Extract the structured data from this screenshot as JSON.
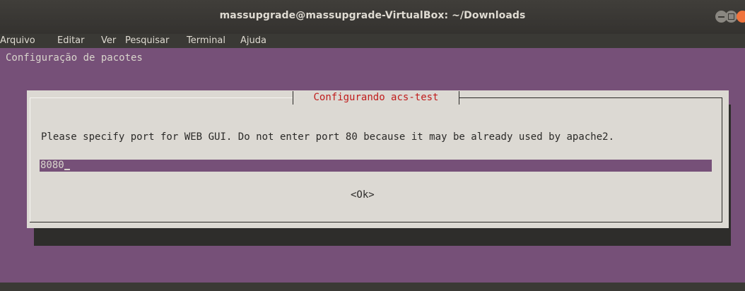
{
  "window": {
    "title": "massupgrade@massupgrade-VirtualBox: ~/Downloads"
  },
  "menu": {
    "items": [
      "Arquivo",
      "Editar",
      "Ver",
      "Pesquisar",
      "Terminal",
      "Ajuda"
    ]
  },
  "terminal": {
    "header": "Configuração de pacotes"
  },
  "dialog": {
    "title": "Configurando acs-test",
    "prompt": "Please specify port for WEB GUI. Do not enter port 80 because it may be already used by apache2.",
    "input_value": "8080",
    "ok_label": "<Ok>"
  },
  "colors": {
    "terminal_background": "#765078",
    "dialog_background": "#dcd9d3",
    "dialog_title": "#c01c1c",
    "close_button": "#f0733c"
  },
  "icons": [
    "minimize-icon",
    "maximize-icon",
    "close-icon"
  ]
}
